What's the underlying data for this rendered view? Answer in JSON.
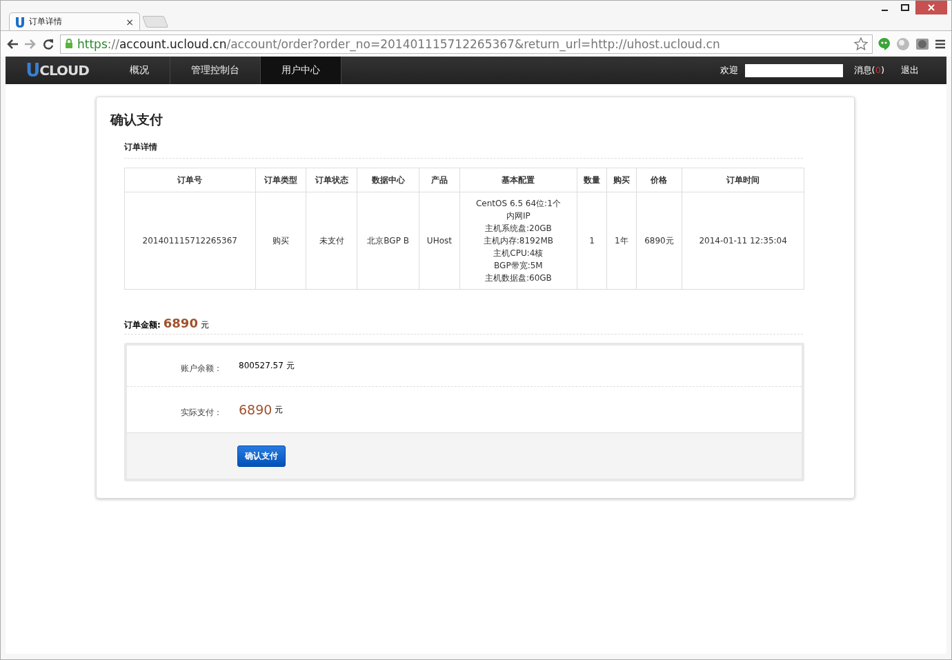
{
  "browser": {
    "tab": {
      "title": "订单详情",
      "close": "×"
    },
    "url": {
      "scheme": "https",
      "sep": "://",
      "host": "account.ucloud.cn",
      "path": "/account/order?order_no=20140111571226536­7&return_url=http://uhost.ucloud.cn"
    }
  },
  "nav": {
    "logo": {
      "initial": "U",
      "rest": "CLOUD"
    },
    "items": [
      {
        "label": "概况",
        "selected": false
      },
      {
        "label": "管理控制台",
        "selected": false
      },
      {
        "label": "用户中心",
        "selected": true
      }
    ],
    "welcome": "欢迎",
    "messages": {
      "prefix": "消息(",
      "count": "0",
      "suffix": ")"
    },
    "logout": "退出"
  },
  "page": {
    "title": "确认支付",
    "section": "订单详情",
    "table": {
      "columns": [
        "订单号",
        "订单类型",
        "订单状态",
        "数据中心",
        "产品",
        "基本配置",
        "数量",
        "购买",
        "价格",
        "订单时间"
      ],
      "rows": [
        {
          "cells": [
            "20140111571226536­7",
            "购买",
            "未支付",
            "北京BGP B",
            "UHost",
            [
              "CentOS 6.5 64位:1个",
              "内网IP",
              "主机系统盘:20GB",
              "主机内存:8192MB",
              "主机CPU:4核",
              "BGP带宽:5M",
              "主机数据盘:60GB"
            ],
            "1",
            "1年",
            "6890元",
            "2014-01-11 12:35:04"
          ]
        }
      ]
    },
    "total": {
      "label": "订单金额:",
      "amount": "6890",
      "unit": "元"
    },
    "payment": {
      "balance_label": "账户余额：",
      "balance": "800527.57 元",
      "pay_label": "实际支付：",
      "pay_amount": "6890",
      "pay_unit": "元",
      "confirm": "确认支付"
    }
  }
}
